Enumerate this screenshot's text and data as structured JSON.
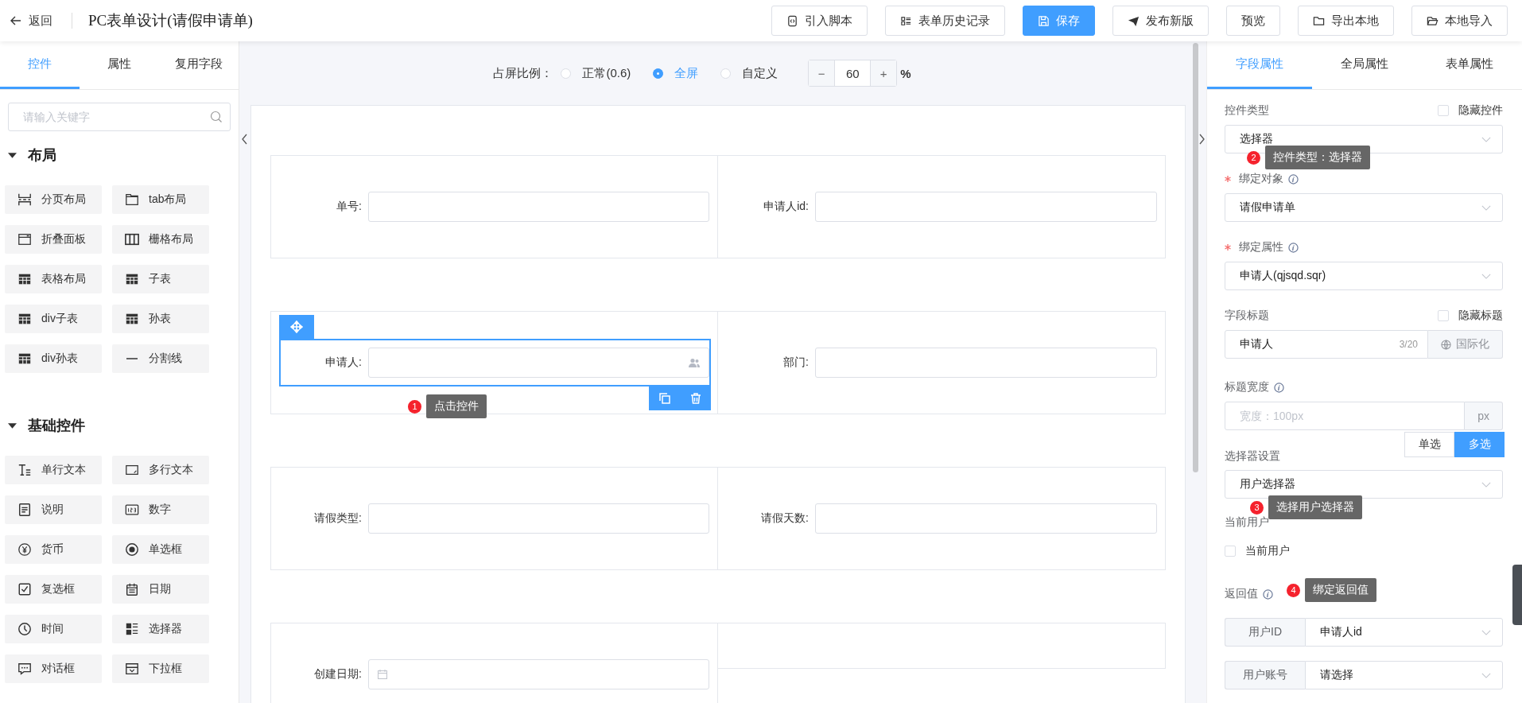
{
  "header": {
    "back": "返回",
    "title": "PC表单设计(请假申请单)",
    "buttons": [
      {
        "label": "引入脚本",
        "kind": "default"
      },
      {
        "label": "表单历史记录",
        "kind": "default"
      },
      {
        "label": "保存",
        "kind": "primary"
      },
      {
        "label": "发布新版",
        "kind": "default"
      },
      {
        "label": "预览",
        "kind": "default"
      },
      {
        "label": "导出本地",
        "kind": "default"
      },
      {
        "label": "本地导入",
        "kind": "default"
      }
    ]
  },
  "left_panel": {
    "tabs": [
      {
        "label": "控件",
        "selected": true
      },
      {
        "label": "属性",
        "selected": false
      },
      {
        "label": "复用字段",
        "selected": false
      }
    ],
    "search": {
      "placeholder": "请输入关键字"
    },
    "groups": [
      {
        "title": "布局",
        "expanded": true,
        "items": [
          "分页布局",
          "tab布局",
          "折叠面板",
          "栅格布局",
          "表格布局",
          "子表",
          "div子表",
          "孙表",
          "div孙表",
          "分割线"
        ]
      },
      {
        "title": "基础控件",
        "expanded": true,
        "items": [
          "单行文本",
          "多行文本",
          "说明",
          "数字",
          "货币",
          "单选框",
          "复选框",
          "日期",
          "时间",
          "选择器",
          "对话框",
          "下拉框"
        ]
      }
    ]
  },
  "canvas": {
    "ratio": {
      "label": "占屏比例：",
      "options": [
        {
          "label": "正常(0.6)",
          "selected": false
        },
        {
          "label": "全屏",
          "selected": true
        },
        {
          "label": "自定义",
          "selected": false
        }
      ],
      "minus": "−",
      "value": "60",
      "plus": "+",
      "unit": "%"
    },
    "rows": [
      {
        "cells": [
          {
            "label": "单号:",
            "kind": "text",
            "selected": false
          },
          {
            "label": "申请人id:",
            "kind": "text",
            "selected": false
          }
        ]
      },
      {
        "cells": [
          {
            "label": "申请人:",
            "kind": "user",
            "selected": true,
            "annotation": {
              "number": "1",
              "text": "点击控件"
            }
          },
          {
            "label": "部门:",
            "kind": "text",
            "selected": false
          }
        ]
      },
      {
        "cells": [
          {
            "label": "请假类型:",
            "kind": "text",
            "selected": false
          },
          {
            "label": "请假天数:",
            "kind": "text",
            "selected": false
          }
        ]
      },
      {
        "cells": [
          {
            "label": "创建日期:",
            "kind": "date",
            "selected": false
          },
          {
            "kind": "empty"
          }
        ]
      }
    ]
  },
  "right_panel": {
    "tabs": [
      {
        "label": "字段属性",
        "selected": true
      },
      {
        "label": "全局属性",
        "selected": false
      },
      {
        "label": "表单属性",
        "selected": false
      }
    ],
    "control_type": {
      "label": "控件类型",
      "hide_label": "隐藏控件",
      "hidden": false,
      "value": "选择器",
      "annotation": {
        "number": "2",
        "text": "控件类型：选择器"
      }
    },
    "bind_object": {
      "label": "绑定对象",
      "required": true,
      "value": "请假申请单"
    },
    "bind_property": {
      "label": "绑定属性",
      "required": true,
      "value": "申请人(qjsqd.sqr)"
    },
    "field_title": {
      "label": "字段标题",
      "hide_label": "隐藏标题",
      "hidden": false,
      "value": "申请人",
      "count": "3/20",
      "i18n": "国际化"
    },
    "title_width": {
      "label": "标题宽度",
      "placeholder": "宽度：100px",
      "unit": "px"
    },
    "selector": {
      "label": "选择器设置",
      "modes": [
        {
          "label": "单选",
          "selected": false
        },
        {
          "label": "多选",
          "selected": true
        }
      ],
      "value": "用户选择器",
      "annotation": {
        "number": "3",
        "text": "选择用户选择器"
      }
    },
    "current_user": {
      "label": "当前用户",
      "option": "当前用户",
      "checked": false
    },
    "return_value": {
      "label": "返回值",
      "annotation": {
        "number": "4",
        "text": "绑定返回值"
      },
      "rows": [
        {
          "name": "用户ID",
          "value": "申请人id"
        },
        {
          "name": "用户账号",
          "value": "请选择"
        }
      ]
    }
  }
}
